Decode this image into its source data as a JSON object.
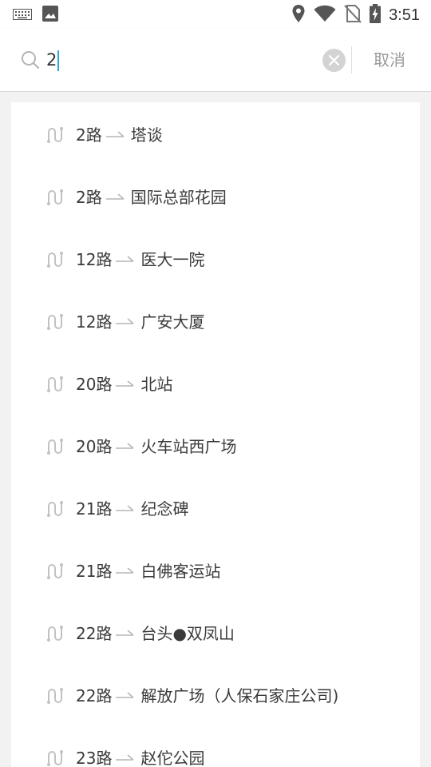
{
  "status_bar": {
    "time": "3:51",
    "icons": [
      "keyboard-icon",
      "image-icon",
      "location-icon",
      "wifi-icon",
      "no-sim-icon",
      "battery-charging-icon"
    ]
  },
  "search": {
    "value": "2",
    "cancel_label": "取消"
  },
  "results": [
    {
      "route": "2路",
      "destination": "塔谈"
    },
    {
      "route": "2路",
      "destination": "国际总部花园"
    },
    {
      "route": "12路",
      "destination": "医大一院"
    },
    {
      "route": "12路",
      "destination": "广安大厦"
    },
    {
      "route": "20路",
      "destination": "北站"
    },
    {
      "route": "20路",
      "destination": "火车站西广场"
    },
    {
      "route": "21路",
      "destination": "纪念碑"
    },
    {
      "route": "21路",
      "destination": "白佛客运站"
    },
    {
      "route": "22路",
      "destination": "台头●双凤山"
    },
    {
      "route": "22路",
      "destination": "解放广场（人保石家庄公司)"
    },
    {
      "route": "23路",
      "destination": "赵佗公园"
    }
  ],
  "colors": {
    "accent_caret": "#2aa6d8",
    "text": "#3a3a3a",
    "muted": "#9a9a9a",
    "background": "#f2f2f2"
  }
}
